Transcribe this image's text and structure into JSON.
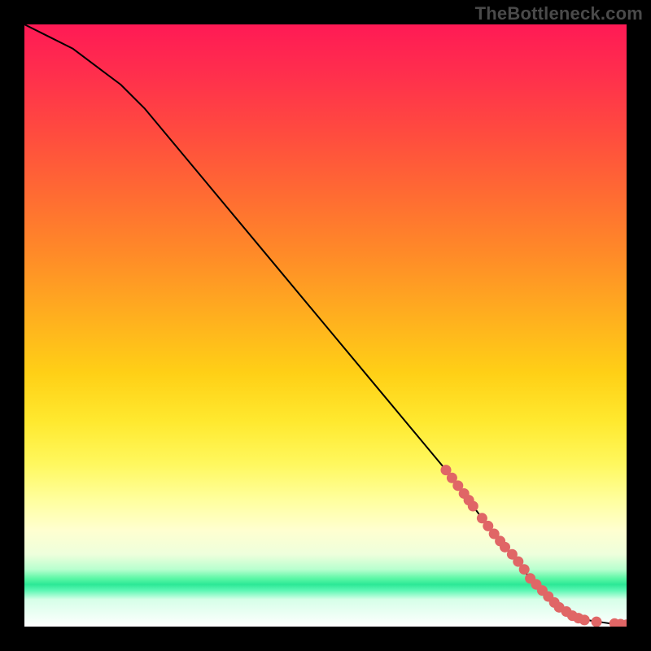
{
  "watermark": "TheBottleneck.com",
  "chart_data": {
    "type": "line",
    "title": "",
    "xlabel": "",
    "ylabel": "",
    "xlim": [
      0,
      100
    ],
    "ylim": [
      0,
      100
    ],
    "curve": {
      "name": "bottleneck-curve",
      "x": [
        0,
        4,
        8,
        12,
        16,
        20,
        30,
        40,
        50,
        60,
        70,
        76,
        80,
        84,
        86,
        88,
        90,
        92,
        94,
        96,
        98,
        100
      ],
      "y": [
        100,
        98,
        96,
        93,
        90,
        86,
        74,
        62,
        50,
        38,
        26,
        18,
        13,
        8,
        6,
        4,
        2.5,
        1.5,
        1,
        0.7,
        0.4,
        0.3
      ]
    },
    "marker_series": {
      "name": "highlighted-points",
      "color": "#e06666",
      "points": [
        {
          "x": 70.0,
          "y": 26.0
        },
        {
          "x": 71.0,
          "y": 24.7
        },
        {
          "x": 72.0,
          "y": 23.4
        },
        {
          "x": 73.0,
          "y": 22.1
        },
        {
          "x": 73.8,
          "y": 21.0
        },
        {
          "x": 74.5,
          "y": 20.0
        },
        {
          "x": 76.0,
          "y": 18.0
        },
        {
          "x": 77.0,
          "y": 16.7
        },
        {
          "x": 78.0,
          "y": 15.4
        },
        {
          "x": 79.0,
          "y": 14.2
        },
        {
          "x": 79.8,
          "y": 13.2
        },
        {
          "x": 81.0,
          "y": 12.0
        },
        {
          "x": 82.0,
          "y": 10.8
        },
        {
          "x": 83.0,
          "y": 9.5
        },
        {
          "x": 84.0,
          "y": 8.0
        },
        {
          "x": 85.0,
          "y": 7.0
        },
        {
          "x": 86.0,
          "y": 6.0
        },
        {
          "x": 87.0,
          "y": 5.0
        },
        {
          "x": 88.0,
          "y": 4.0
        },
        {
          "x": 88.8,
          "y": 3.2
        },
        {
          "x": 90.0,
          "y": 2.5
        },
        {
          "x": 91.0,
          "y": 1.8
        },
        {
          "x": 92.0,
          "y": 1.4
        },
        {
          "x": 93.0,
          "y": 1.1
        },
        {
          "x": 95.0,
          "y": 0.8
        },
        {
          "x": 98.0,
          "y": 0.5
        },
        {
          "x": 99.0,
          "y": 0.4
        },
        {
          "x": 100.0,
          "y": 0.3
        }
      ]
    }
  }
}
